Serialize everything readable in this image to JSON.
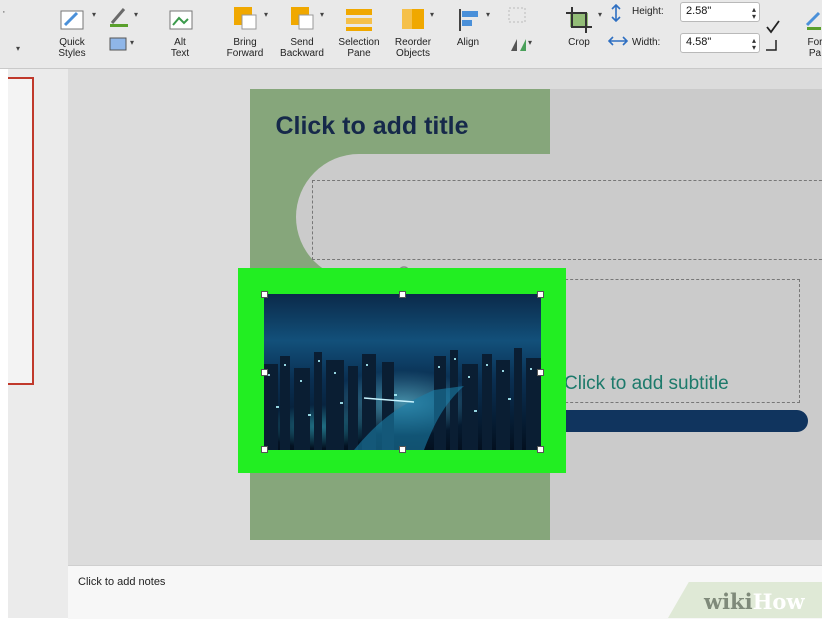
{
  "ribbon": {
    "quick_styles": "Quick\nStyles",
    "alt_text": "Alt\nText",
    "bring_forward": "Bring\nForward",
    "send_backward": "Send\nBackward",
    "selection_pane": "Selection\nPane",
    "reorder_objects": "Reorder\nObjects",
    "align": "Align",
    "crop": "Crop",
    "height_label": "Height:",
    "height_value": "2.58\"",
    "width_label": "Width:",
    "width_value": "4.58\"",
    "format_pane_partial": "For\nPa"
  },
  "slide": {
    "title_placeholder": "Click to add title",
    "subtitle_placeholder": "Click to add subtitle"
  },
  "notes": {
    "placeholder": "Click to add notes"
  },
  "watermark": {
    "part1": "wiki",
    "part2": "How"
  },
  "colors": {
    "highlight": "#22ee22",
    "slide_green": "#86a67b",
    "title_color": "#16294a",
    "subtitle_color": "#1d7a6b",
    "accent_bar": "#10345e"
  }
}
